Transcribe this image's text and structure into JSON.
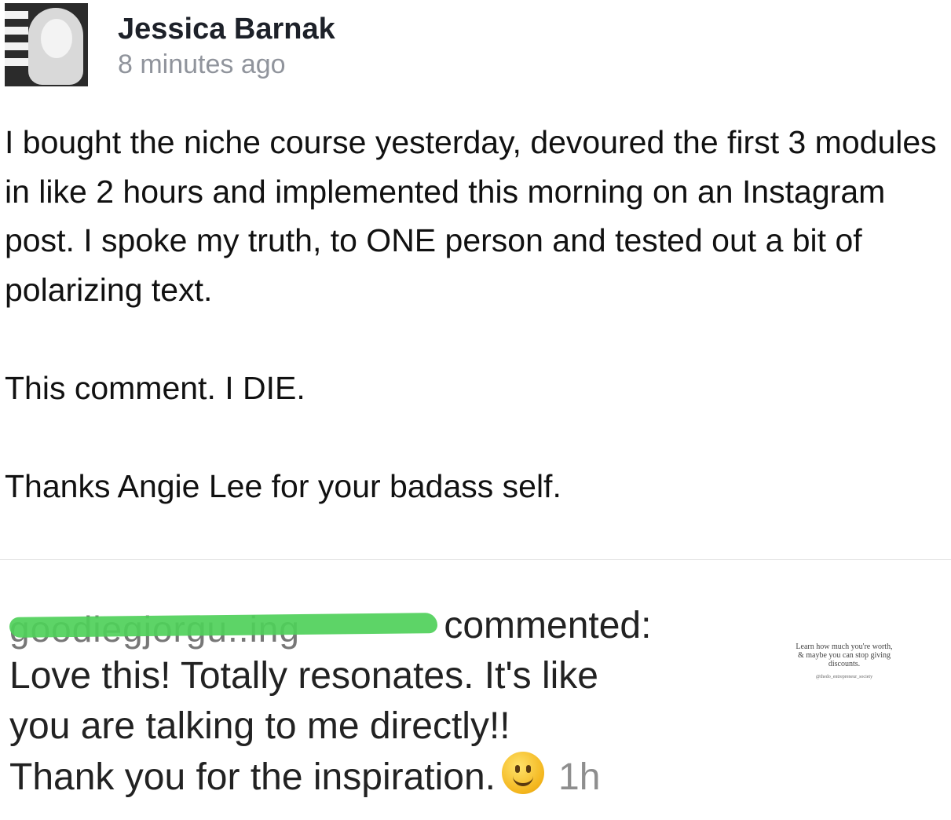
{
  "post": {
    "author": "Jessica Barnak",
    "time": "8 minutes ago",
    "paragraphs": [
      "I bought the niche course yesterday, devoured the first 3 modules in like 2 hours and implemented this morning on an Instagram post. I spoke my truth, to ONE person and tested out a bit of polarizing text.",
      "This comment. I DIE."
    ],
    "thanks_prefix": "Thanks ",
    "mention": "Angie Lee",
    "thanks_suffix": " for your badass self."
  },
  "comment": {
    "redacted_username": "goodiegjorgu..ing",
    "verb": "commented:",
    "lines": [
      "Love this! Totally resonates. It's like",
      "you are talking to me directly!!"
    ],
    "last_line": "Thank you for the inspiration.",
    "emoji": "slightly-smiling-face",
    "age": "1h"
  },
  "thumbnail": {
    "quote": "Learn how much you're worth, & maybe you can stop giving discounts.",
    "signature": "@thedo_entrepreneur_society"
  }
}
